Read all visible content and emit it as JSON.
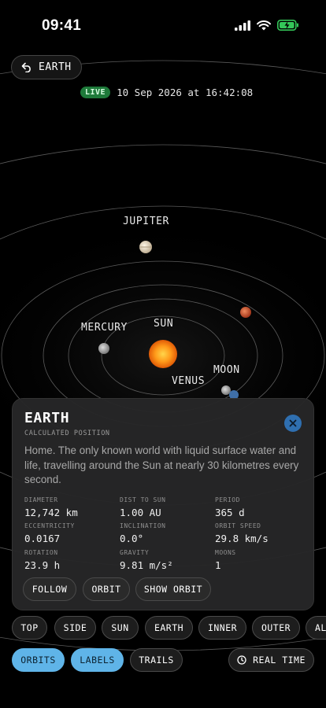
{
  "status_bar": {
    "time": "09:41",
    "battery_color": "#34c759"
  },
  "back": {
    "label": "EARTH"
  },
  "live": {
    "badge": "LIVE",
    "datetime": "10 Sep 2026 at 16:42:08",
    "color": "#1e7a3a"
  },
  "labels": {
    "jupiter": "JUPITER",
    "mercury": "MERCURY",
    "sun": "SUN",
    "moon": "MOON",
    "venus": "VENUS"
  },
  "card": {
    "title": "EARTH",
    "subtitle": "CALCULATED POSITION",
    "description": "Home. The only known world with liquid surface water and life, travelling around the Sun at nearly 30 kilometres every second.",
    "stats": [
      {
        "key": "DIAMETER",
        "value": "12,742 km"
      },
      {
        "key": "DIST TO SUN",
        "value": "1.00 AU"
      },
      {
        "key": "PERIOD",
        "value": "365 d"
      },
      {
        "key": "ECCENTRICITY",
        "value": "0.0167"
      },
      {
        "key": "INCLINATION",
        "value": "0.0°"
      },
      {
        "key": "ORBIT SPEED",
        "value": "29.8 km/s"
      },
      {
        "key": "ROTATION",
        "value": "23.9 h"
      },
      {
        "key": "GRAVITY",
        "value": "9.81 m/s²"
      },
      {
        "key": "MOONS",
        "value": "1"
      }
    ],
    "actions": {
      "follow": "FOLLOW",
      "orbit": "ORBIT",
      "show_orbit": "SHOW ORBIT"
    }
  },
  "views": [
    "TOP",
    "SIDE",
    "SUN",
    "EARTH",
    "INNER",
    "OUTER",
    "AL"
  ],
  "toggles": {
    "orbits": "ORBITS",
    "labels": "LABELS",
    "trails": "TRAILS",
    "real_time": "REAL TIME"
  },
  "accent": "#5fb4e8"
}
